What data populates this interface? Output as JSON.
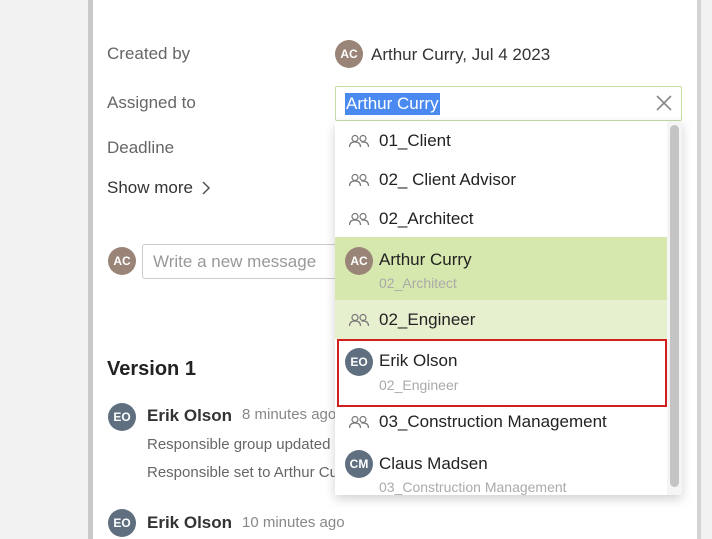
{
  "details": {
    "created_by_label": "Created by",
    "created_by_initials": "AC",
    "created_by_value": "Arthur Curry, Jul 4 2023",
    "assigned_to_label": "Assigned to",
    "assigned_to_value": "Arthur Curry",
    "deadline_label": "Deadline",
    "show_more_label": "Show more"
  },
  "composer": {
    "avatar_initials": "AC",
    "placeholder": "Write a new message"
  },
  "history": {
    "version_title": "Version 1",
    "entries": [
      {
        "initials": "EO",
        "name": "Erik Olson",
        "time": "8 minutes ago",
        "lines": [
          "Responsible group updated",
          "Responsible set to Arthur Cu"
        ]
      },
      {
        "initials": "EO",
        "name": "Erik Olson",
        "time": "10 minutes ago",
        "lines": []
      }
    ]
  },
  "dropdown": {
    "items": [
      {
        "type": "group",
        "label": "01_Client"
      },
      {
        "type": "group",
        "label": "02_ Client Advisor"
      },
      {
        "type": "group",
        "label": "02_Architect"
      },
      {
        "type": "user",
        "initials": "AC",
        "name": "Arthur Curry",
        "group": "02_Architect",
        "state": "selected"
      },
      {
        "type": "group",
        "label": "02_Engineer",
        "state": "highlighted"
      },
      {
        "type": "user",
        "initials": "EO",
        "name": "Erik Olson",
        "group": "02_Engineer",
        "state": "focused"
      },
      {
        "type": "group",
        "label": "03_Construction Management"
      },
      {
        "type": "user",
        "initials": "CM",
        "name": "Claus Madsen",
        "group": "03_Construction Management"
      }
    ]
  },
  "colors": {
    "selected_bg": "#d6e8ad",
    "highlight_bg": "#e6f0cf",
    "focus_outline": "#d11f1f",
    "text_selection": "#4a8af0"
  },
  "icons": {
    "group": "group-icon",
    "clear": "close-icon",
    "show_more": "chevron-right-icon"
  }
}
